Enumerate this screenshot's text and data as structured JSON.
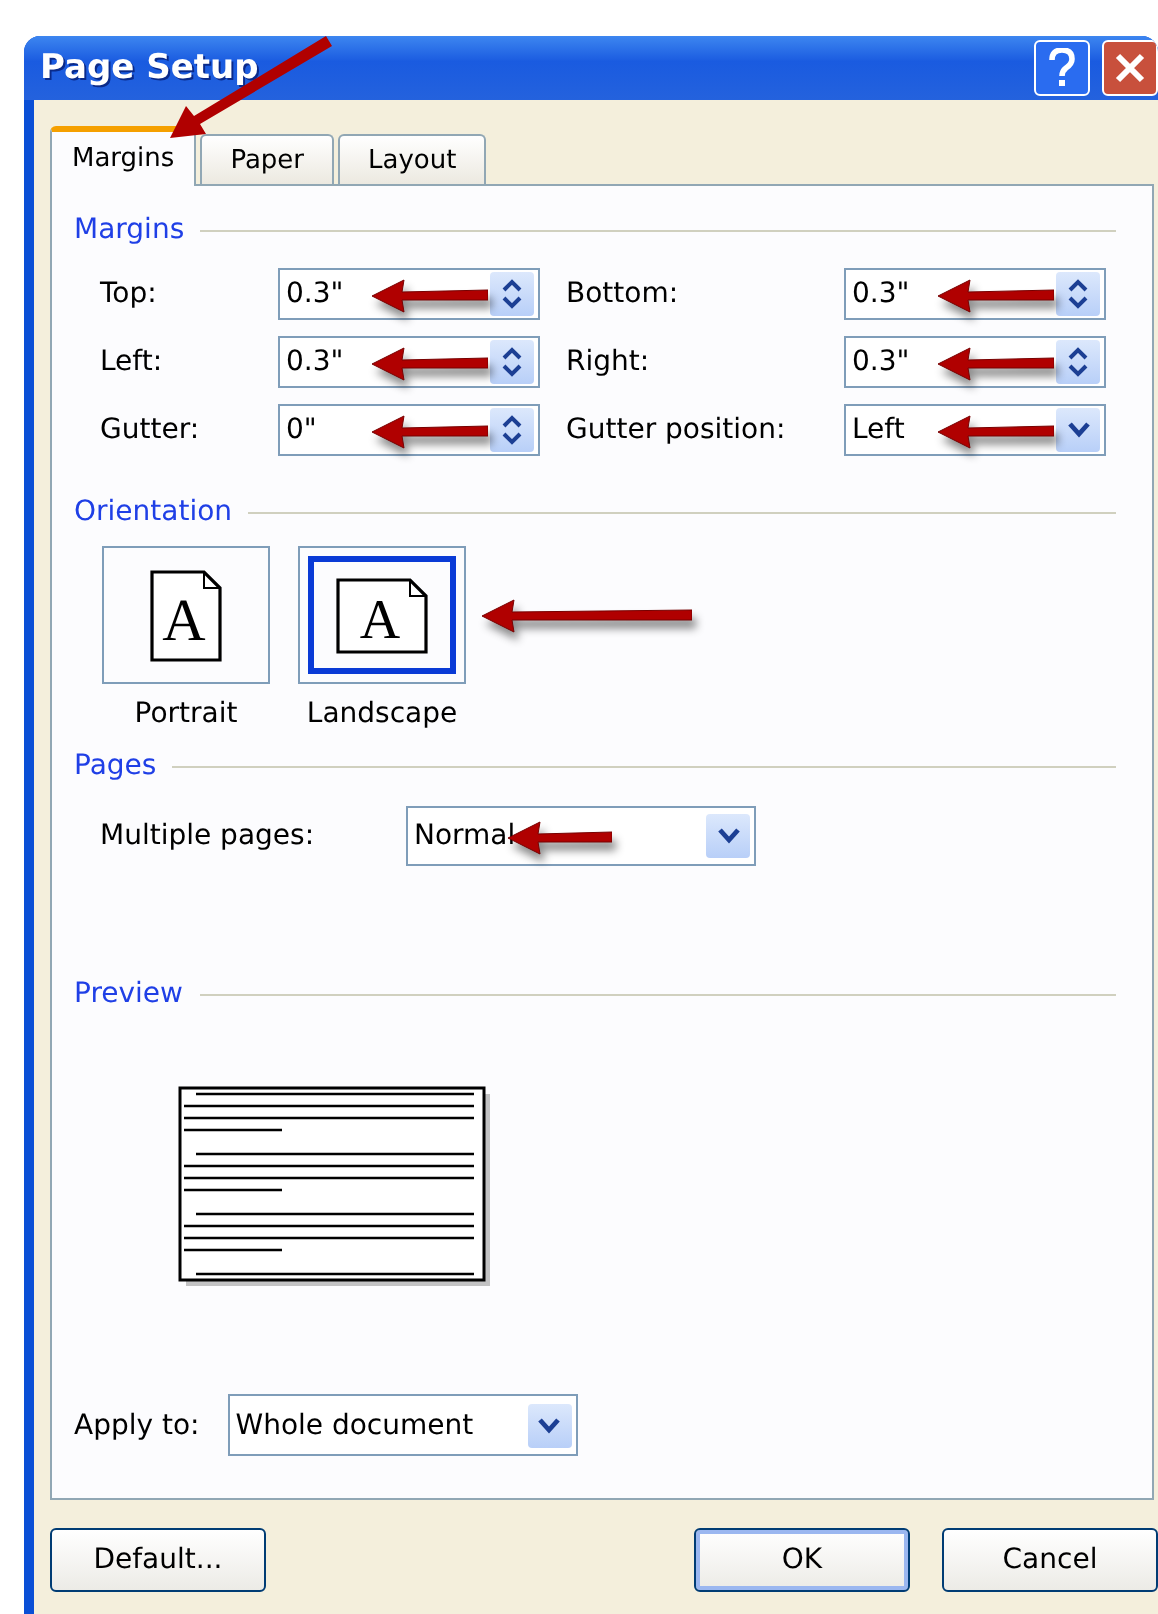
{
  "window": {
    "title": "Page Setup"
  },
  "tabs": [
    {
      "label": "Margins",
      "selected": true,
      "annotated": true
    },
    {
      "label": "Paper",
      "selected": false,
      "annotated": false
    },
    {
      "label": "Layout",
      "selected": false,
      "annotated": false
    }
  ],
  "margins": {
    "heading": "Margins",
    "fields": [
      {
        "label": "Top:",
        "value": "0.3\"",
        "kind": "spin",
        "annotated": true
      },
      {
        "label": "Bottom:",
        "value": "0.3\"",
        "kind": "spin",
        "annotated": true
      },
      {
        "label": "Left:",
        "value": "0.3\"",
        "kind": "spin",
        "annotated": true
      },
      {
        "label": "Right:",
        "value": "0.3\"",
        "kind": "spin",
        "annotated": true
      },
      {
        "label": "Gutter:",
        "value": "0\"",
        "kind": "spin",
        "annotated": true
      },
      {
        "label": "Gutter position:",
        "value": "Left",
        "kind": "dropdown",
        "annotated": true
      }
    ]
  },
  "orientation": {
    "heading": "Orientation",
    "options": [
      {
        "label": "Portrait",
        "glyph": "A",
        "selected": false,
        "annotated": false
      },
      {
        "label": "Landscape",
        "glyph": "A",
        "selected": true,
        "annotated": true
      }
    ]
  },
  "pages": {
    "heading": "Pages",
    "label": "Multiple pages:",
    "value": "Normal",
    "annotated": true
  },
  "preview": {
    "heading": "Preview",
    "apply_label": "Apply to:",
    "apply_value": "Whole document"
  },
  "buttons": [
    {
      "label": "Default...",
      "default": false
    },
    {
      "label": "OK",
      "default": true
    },
    {
      "label": "Cancel",
      "default": false
    }
  ]
}
